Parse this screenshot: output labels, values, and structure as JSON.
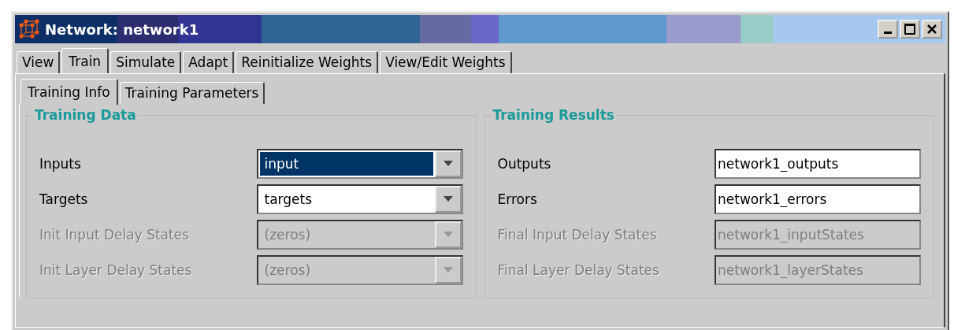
{
  "window": {
    "title": "Network: network1"
  },
  "tabs": [
    {
      "label": "View",
      "selected": false
    },
    {
      "label": "Train",
      "selected": true
    },
    {
      "label": "Simulate",
      "selected": false
    },
    {
      "label": "Adapt",
      "selected": false
    },
    {
      "label": "Reinitialize Weights",
      "selected": false
    },
    {
      "label": "View/Edit Weights",
      "selected": false
    }
  ],
  "subtabs": [
    {
      "label": "Training Info",
      "selected": true
    },
    {
      "label": "Training Parameters",
      "selected": false
    }
  ],
  "sections": [
    {
      "title": "Training Data",
      "rows": [
        {
          "label": "Inputs",
          "kind": "combo",
          "value": "input",
          "disabled": false,
          "highlighted": true
        },
        {
          "label": "Targets",
          "kind": "combo",
          "value": "targets",
          "disabled": false,
          "highlighted": false
        },
        {
          "label": "Init Input Delay States",
          "kind": "combo",
          "value": "(zeros)",
          "disabled": true,
          "highlighted": false
        },
        {
          "label": "Init Layer Delay States",
          "kind": "combo",
          "value": "(zeros)",
          "disabled": true,
          "highlighted": false
        }
      ]
    },
    {
      "title": "Training Results",
      "rows": [
        {
          "label": "Outputs",
          "kind": "text",
          "value": "network1_outputs",
          "disabled": false
        },
        {
          "label": "Errors",
          "kind": "text",
          "value": "network1_errors",
          "disabled": false
        },
        {
          "label": "Final Input Delay States",
          "kind": "text",
          "value": "network1_inputStates",
          "disabled": true
        },
        {
          "label": "Final Layer Delay States",
          "kind": "text",
          "value": "network1_layerStates",
          "disabled": true
        }
      ]
    }
  ]
}
